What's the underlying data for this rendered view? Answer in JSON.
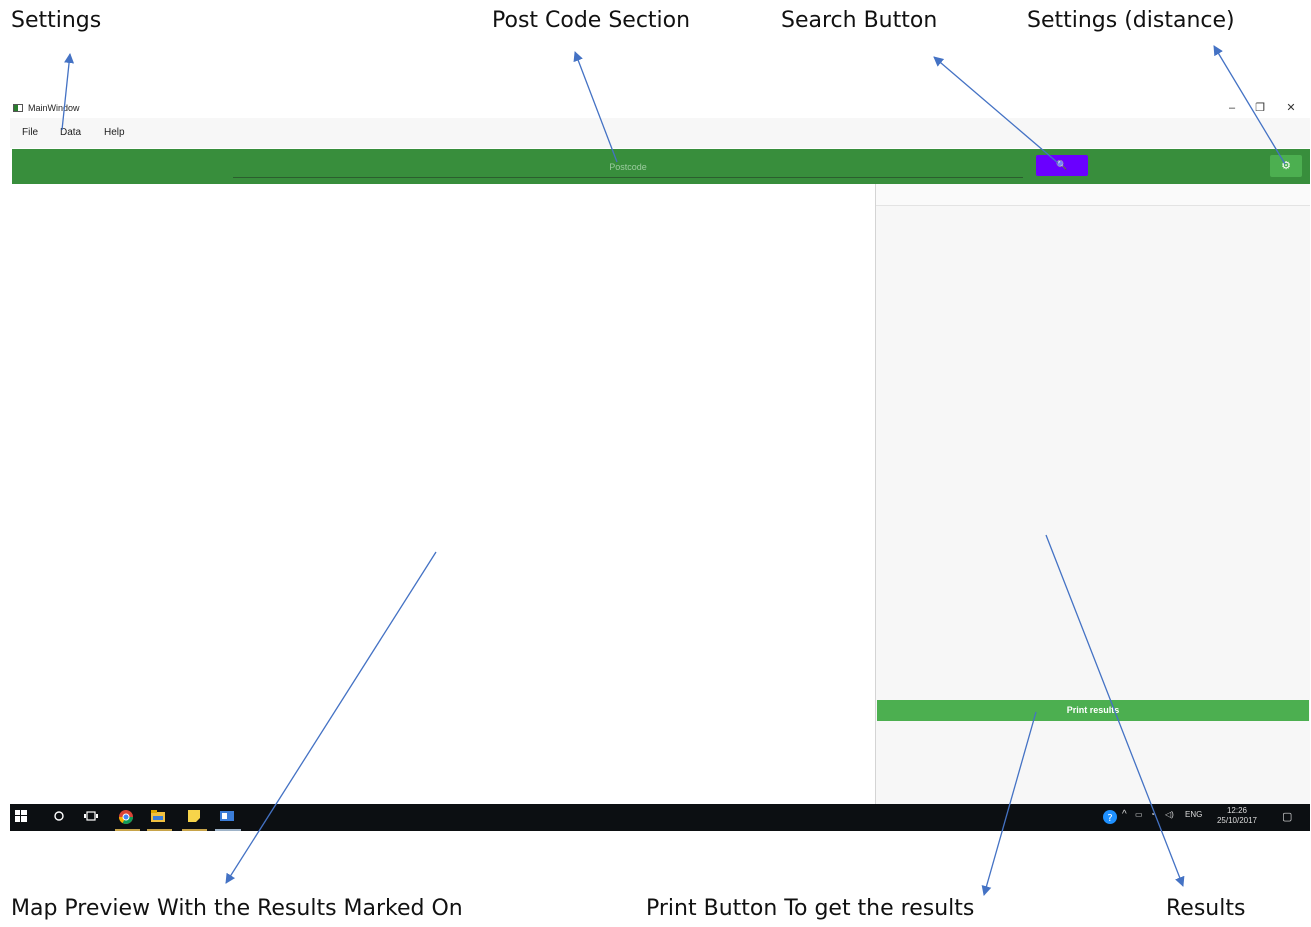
{
  "annotations": {
    "settings": "Settings",
    "postcode_section": "Post  Code Section",
    "search_button": "Search Button",
    "settings_distance": "Settings (distance)",
    "map_preview": "Map Preview With the Results Marked On",
    "print_button": "Print Button To get the results",
    "results": "Results"
  },
  "window": {
    "title": "MainWindow",
    "minimize_glyph": "–",
    "restore_glyph": "❐",
    "close_glyph": "✕"
  },
  "menu": {
    "items": [
      "File",
      "Data",
      "Help"
    ]
  },
  "toolbar": {
    "postcode_placeholder": "Postcode",
    "search_icon": "🔍",
    "settings_icon": "⚙",
    "bg_color": "#388e3c",
    "search_color": "#6a00ff"
  },
  "results_panel": {
    "print_label": "Print results",
    "print_color": "#4caf50"
  },
  "taskbar": {
    "start_icon": "windows-icon",
    "tray_lang": "ENG",
    "clock_time": "12:26",
    "clock_date": "25/10/2017"
  }
}
